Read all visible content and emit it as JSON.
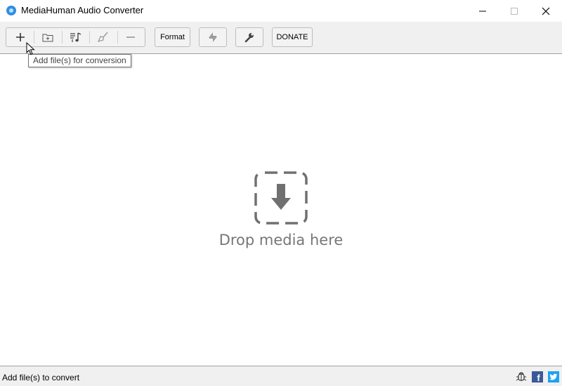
{
  "window": {
    "title": "MediaHuman Audio Converter"
  },
  "toolbar": {
    "group_buttons": [
      {
        "name": "add-files-button",
        "icon": "plus-icon"
      },
      {
        "name": "add-folder-button",
        "icon": "folder-plus-icon"
      },
      {
        "name": "add-from-itunes-button",
        "icon": "playlist-music-icon"
      },
      {
        "name": "clear-list-button",
        "icon": "broom-icon"
      },
      {
        "name": "remove-item-button",
        "icon": "minus-icon"
      }
    ],
    "format_label": "Format",
    "donate_label": "DONATE"
  },
  "tooltip": {
    "text": "Add file(s) for conversion"
  },
  "main": {
    "drop_text": "Drop media here"
  },
  "status": {
    "text": "Add file(s) to convert"
  },
  "colors": {
    "accent": "#2f8fe0",
    "facebook": "#3b5998",
    "twitter": "#1da1f2"
  }
}
